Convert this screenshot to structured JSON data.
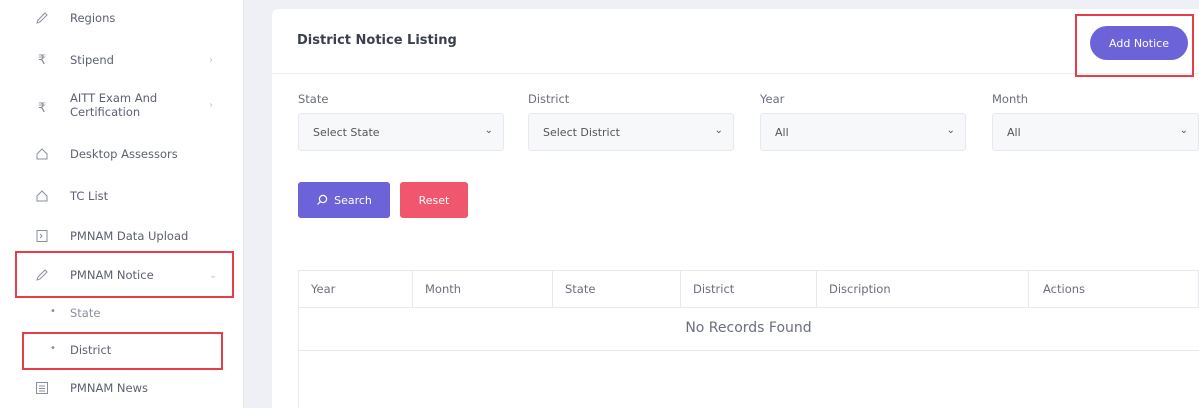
{
  "sidebar": {
    "items": [
      {
        "label": "Regions",
        "icon": "pencil-icon"
      },
      {
        "label": "Stipend",
        "icon": "rupee-icon"
      },
      {
        "label": "AITT Exam And Certification",
        "label_line1": "AITT Exam And",
        "label_line2": "Certification",
        "icon": "rupee-icon"
      },
      {
        "label": "Desktop Assessors",
        "icon": "home-icon"
      },
      {
        "label": "TC List",
        "icon": "home-icon"
      },
      {
        "label": "PMNAM Data Upload",
        "icon": "upload-icon"
      },
      {
        "label": "PMNAM Notice",
        "icon": "pencil-icon"
      },
      {
        "label": "PMNAM News",
        "icon": "list-icon"
      }
    ],
    "sub_items": [
      {
        "label": "State"
      },
      {
        "label": "District"
      }
    ]
  },
  "main": {
    "title": "District Notice Listing",
    "add_button": "Add Notice",
    "filters": [
      {
        "label": "State",
        "value": "Select State"
      },
      {
        "label": "District",
        "value": "Select District"
      },
      {
        "label": "Year",
        "value": "All"
      },
      {
        "label": "Month",
        "value": "All"
      }
    ],
    "search_button": "Search",
    "reset_button": "Reset",
    "table": {
      "columns": [
        "Year",
        "Month",
        "State",
        "District",
        "Discription",
        "Actions"
      ],
      "empty_text": "No Records Found"
    }
  },
  "colors": {
    "primary": "#6c63d9",
    "danger": "#f0566d",
    "highlight": "#e63d49"
  }
}
